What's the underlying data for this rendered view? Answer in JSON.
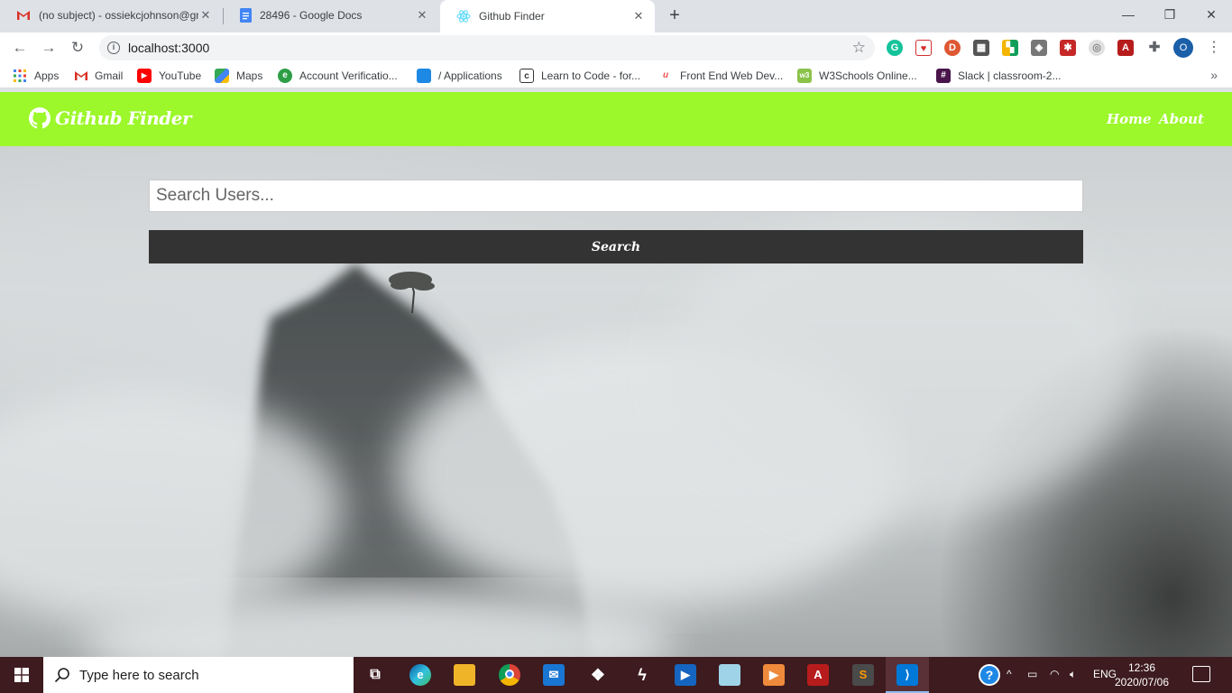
{
  "browser": {
    "tabs": [
      {
        "title": "(no subject) - ossiekcjohnson@gm",
        "icon": "gmail-icon"
      },
      {
        "title": "28496 - Google Docs",
        "icon": "google-docs-icon"
      },
      {
        "title": "Github Finder",
        "icon": "react-icon",
        "active": true
      }
    ],
    "url": "localhost:3000",
    "profile_initial": "O",
    "bookmarks": [
      {
        "label": "Apps",
        "icon": "apps-grid-icon"
      },
      {
        "label": "Gmail",
        "icon": "gmail-icon"
      },
      {
        "label": "YouTube",
        "icon": "youtube-icon"
      },
      {
        "label": "Maps",
        "icon": "maps-icon"
      },
      {
        "label": "Account Verificatio...",
        "icon": "account-verification-icon"
      },
      {
        "label": "/ Applications",
        "icon": "applications-icon"
      },
      {
        "label": "Learn to Code - for...",
        "icon": "freecodecamp-icon"
      },
      {
        "label": "Front End Web Dev...",
        "icon": "udemy-icon"
      },
      {
        "label": "W3Schools Online...",
        "icon": "w3schools-icon"
      },
      {
        "label": "Slack | classroom-2...",
        "icon": "slack-icon"
      }
    ]
  },
  "page": {
    "brand": "Github Finder",
    "nav": {
      "home": "Home",
      "about": "About"
    },
    "search": {
      "placeholder": "Search Users...",
      "button": "Search"
    },
    "navbar_color": "#9cf72b",
    "button_color": "#333333"
  },
  "taskbar": {
    "search_placeholder": "Type here to search",
    "language": "ENG",
    "time": "12:36",
    "date": "2020/07/06"
  }
}
